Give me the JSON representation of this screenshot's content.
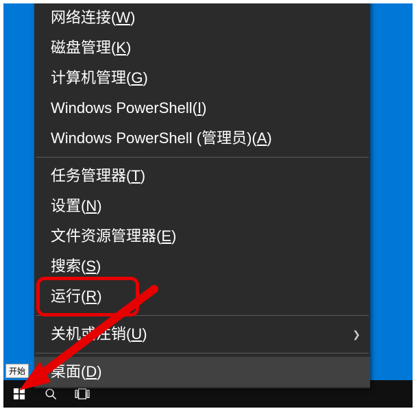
{
  "tooltip": "开始",
  "menu": {
    "items": [
      {
        "text": "网络连接",
        "key": "W"
      },
      {
        "text": "磁盘管理",
        "key": "K"
      },
      {
        "text": "计算机管理",
        "key": "G"
      },
      {
        "text": "Windows PowerShell",
        "key": "I",
        "sep_after": false
      },
      {
        "text": "Windows PowerShell (管理员)",
        "key": "A",
        "sep_after": true
      },
      {
        "text": "任务管理器",
        "key": "T"
      },
      {
        "text": "设置",
        "key": "N"
      },
      {
        "text": "文件资源管理器",
        "key": "E"
      },
      {
        "text": "搜索",
        "key": "S"
      },
      {
        "text": "运行",
        "key": "R",
        "highlighted": true,
        "sep_after": true
      },
      {
        "text": "关机或注销",
        "key": "U",
        "submenu": true,
        "sep_after": true
      },
      {
        "text": "桌面",
        "key": "D",
        "hover": true
      }
    ]
  },
  "annotation": {
    "highlight_target": "运行(R)",
    "arrow_points_to": "start-button"
  }
}
